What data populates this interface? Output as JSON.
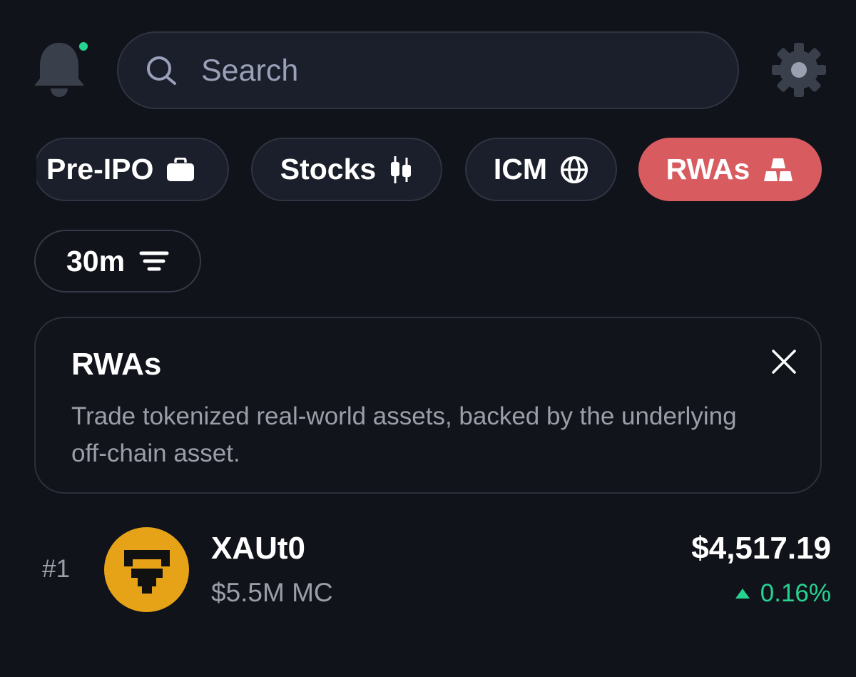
{
  "header": {
    "notification_icon": "bell-icon",
    "has_notification": true,
    "settings_icon": "gear-icon"
  },
  "search": {
    "placeholder": "Search",
    "icon": "search-icon"
  },
  "categories": [
    {
      "label": "Pre-IPO",
      "icon": "briefcase-icon",
      "active": false
    },
    {
      "label": "Stocks",
      "icon": "candlestick-icon",
      "active": false
    },
    {
      "label": "ICM",
      "icon": "globe-icon",
      "active": false
    },
    {
      "label": "RWAs",
      "icon": "gold-bars-icon",
      "active": true
    }
  ],
  "filter": {
    "timeframe_label": "30m",
    "icon": "sort-lines-icon"
  },
  "info_card": {
    "title": "RWAs",
    "description": "Trade tokenized real-world assets, backed by the underlying off-chain asset."
  },
  "assets": [
    {
      "rank": "#1",
      "name": "XAUt0",
      "market_cap": "$5.5M MC",
      "price": "$4,517.19",
      "change": "0.16%",
      "change_direction": "up"
    }
  ],
  "colors": {
    "background": "#11131b",
    "active_chip": "#d85c5f",
    "positive": "#27d390",
    "asset_logo": "#e6a317"
  }
}
